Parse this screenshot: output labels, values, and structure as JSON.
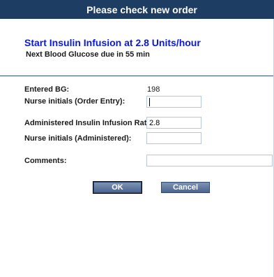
{
  "dialog": {
    "title": "Please check new order"
  },
  "order": {
    "instruction": "Start Insulin Infusion at 2.8 Units/hour",
    "next_bg": "Next Blood Glucose due in 55 min"
  },
  "form": {
    "entered_bg_label": "Entered BG:",
    "entered_bg_value": "198",
    "nurse_initials_order_label": "Nurse initials (Order Entry):",
    "nurse_initials_order_value": "",
    "administered_rate_label": "Administered Insulin Infusion Rate:",
    "administered_rate_value": "2.8",
    "nurse_initials_admin_label": "Nurse initials (Administered):",
    "nurse_initials_admin_value": "",
    "comments_label": "Comments:",
    "comments_value": ""
  },
  "buttons": {
    "ok_label": "OK",
    "cancel_label": "Cancel"
  },
  "colors": {
    "titlebar": "#1e3d62",
    "instruction_text": "#0a18d8",
    "button": "#5a7299"
  }
}
